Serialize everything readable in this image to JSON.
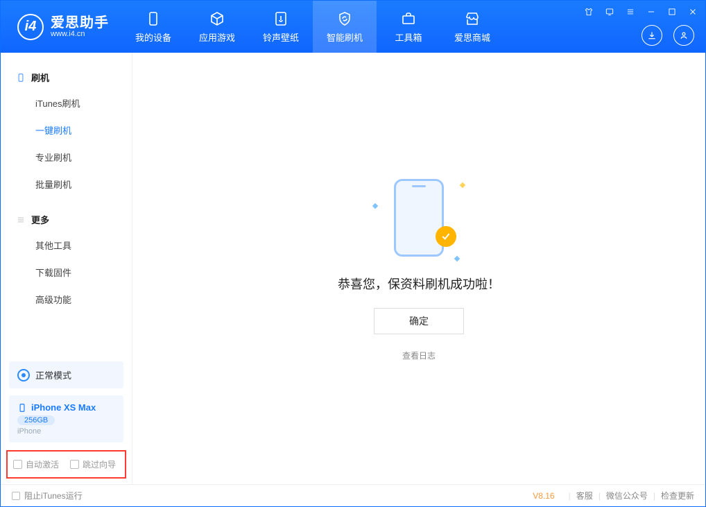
{
  "app": {
    "name": "爱思助手",
    "domain": "www.i4.cn"
  },
  "nav": {
    "tabs": [
      {
        "label": "我的设备"
      },
      {
        "label": "应用游戏"
      },
      {
        "label": "铃声壁纸"
      },
      {
        "label": "智能刷机"
      },
      {
        "label": "工具箱"
      },
      {
        "label": "爱思商城"
      }
    ]
  },
  "sidebar": {
    "section1": {
      "title": "刷机",
      "items": [
        {
          "label": "iTunes刷机"
        },
        {
          "label": "一键刷机"
        },
        {
          "label": "专业刷机"
        },
        {
          "label": "批量刷机"
        }
      ]
    },
    "section2": {
      "title": "更多",
      "items": [
        {
          "label": "其他工具"
        },
        {
          "label": "下载固件"
        },
        {
          "label": "高级功能"
        }
      ]
    },
    "mode_label": "正常模式",
    "device": {
      "name": "iPhone XS Max",
      "storage": "256GB",
      "type": "iPhone"
    },
    "bottom_checks": {
      "auto_activate": "自动激活",
      "skip_guide": "跳过向导"
    }
  },
  "main": {
    "success_text": "恭喜您，保资料刷机成功啦！",
    "ok_label": "确定",
    "log_link": "查看日志"
  },
  "statusbar": {
    "block_itunes": "阻止iTunes运行",
    "version": "V8.16",
    "links": {
      "support": "客服",
      "wechat": "微信公众号",
      "update": "检查更新"
    }
  }
}
